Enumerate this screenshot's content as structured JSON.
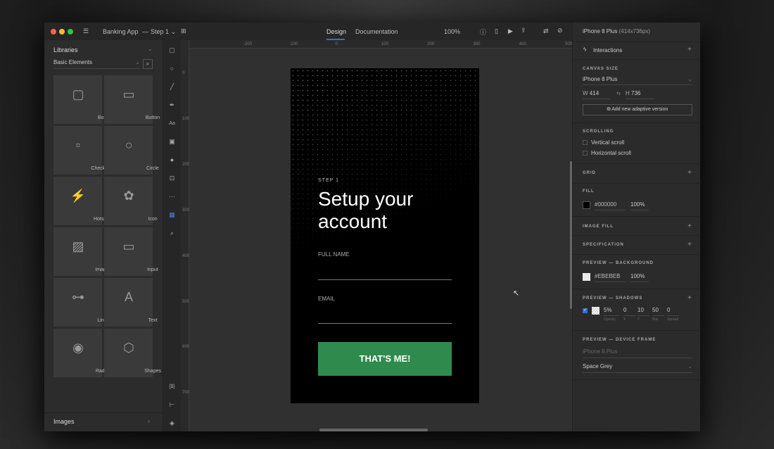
{
  "toolbar": {
    "app_title": "Banking App",
    "separator": "—",
    "page": "Step 1 ⌄",
    "tabs": [
      "Design",
      "Documentation"
    ],
    "zoom": "100%"
  },
  "libraries": {
    "title": "Libraries",
    "filter": "Basic Elements",
    "items": [
      "Box",
      "Button",
      "Checkbox",
      "Circle",
      "Hotspot",
      "Icon",
      "Image",
      "Input",
      "Line",
      "Text",
      "Radio",
      "Shapes"
    ],
    "footer": "Images",
    "button_tile_text": "Button",
    "input_tile_text": "Input"
  },
  "ruler": {
    "x": [
      "-200",
      "-100",
      "0",
      "100",
      "200",
      "300",
      "400",
      "500"
    ],
    "y": [
      "0",
      "100",
      "200",
      "300",
      "400",
      "500",
      "600",
      "700"
    ]
  },
  "screen": {
    "step": "STEP 1",
    "title_line1": "Setup your",
    "title_line2": "account",
    "full_name_label": "FULL NAME",
    "email_label": "EMAIL",
    "cta": "THAT'S ME!",
    "cta_color": "#2f8a4e"
  },
  "panel": {
    "device": "iPhone 8 Plus",
    "device_size": "(414x736px)",
    "interactions": "Interactions",
    "canvas_size": {
      "title": "CANVAS SIZE",
      "preset": "iPhone 8 Plus",
      "w_label": "W",
      "w": "414",
      "h_label": "H",
      "h": "736",
      "adaptive": "Add new adaptive version"
    },
    "scrolling": {
      "title": "SCROLLING",
      "vertical": "Vertical scroll",
      "horizontal": "Horizontal scroll"
    },
    "grid": "GRID",
    "fill": {
      "title": "FILL",
      "hex": "#000000",
      "opacity": "100%",
      "color": "#000000"
    },
    "image_fill": "IMAGE FILL",
    "specification": "SPECIFICATION",
    "preview_bg": {
      "title": "PREVIEW — BACKGROUND",
      "hex": "#EBEBEB",
      "opacity": "100%",
      "color": "#EBEBEB"
    },
    "shadows": {
      "title": "PREVIEW — SHADOWS",
      "checked": true,
      "values": [
        "5%",
        "0",
        "10",
        "50",
        "0"
      ],
      "labels": [
        "Opacity",
        "X",
        "Y",
        "Blur",
        "Spread"
      ]
    },
    "device_frame": {
      "title": "PREVIEW — DEVICE FRAME",
      "device": "iPhone 8 Plus",
      "frame": "Space Grey"
    }
  }
}
